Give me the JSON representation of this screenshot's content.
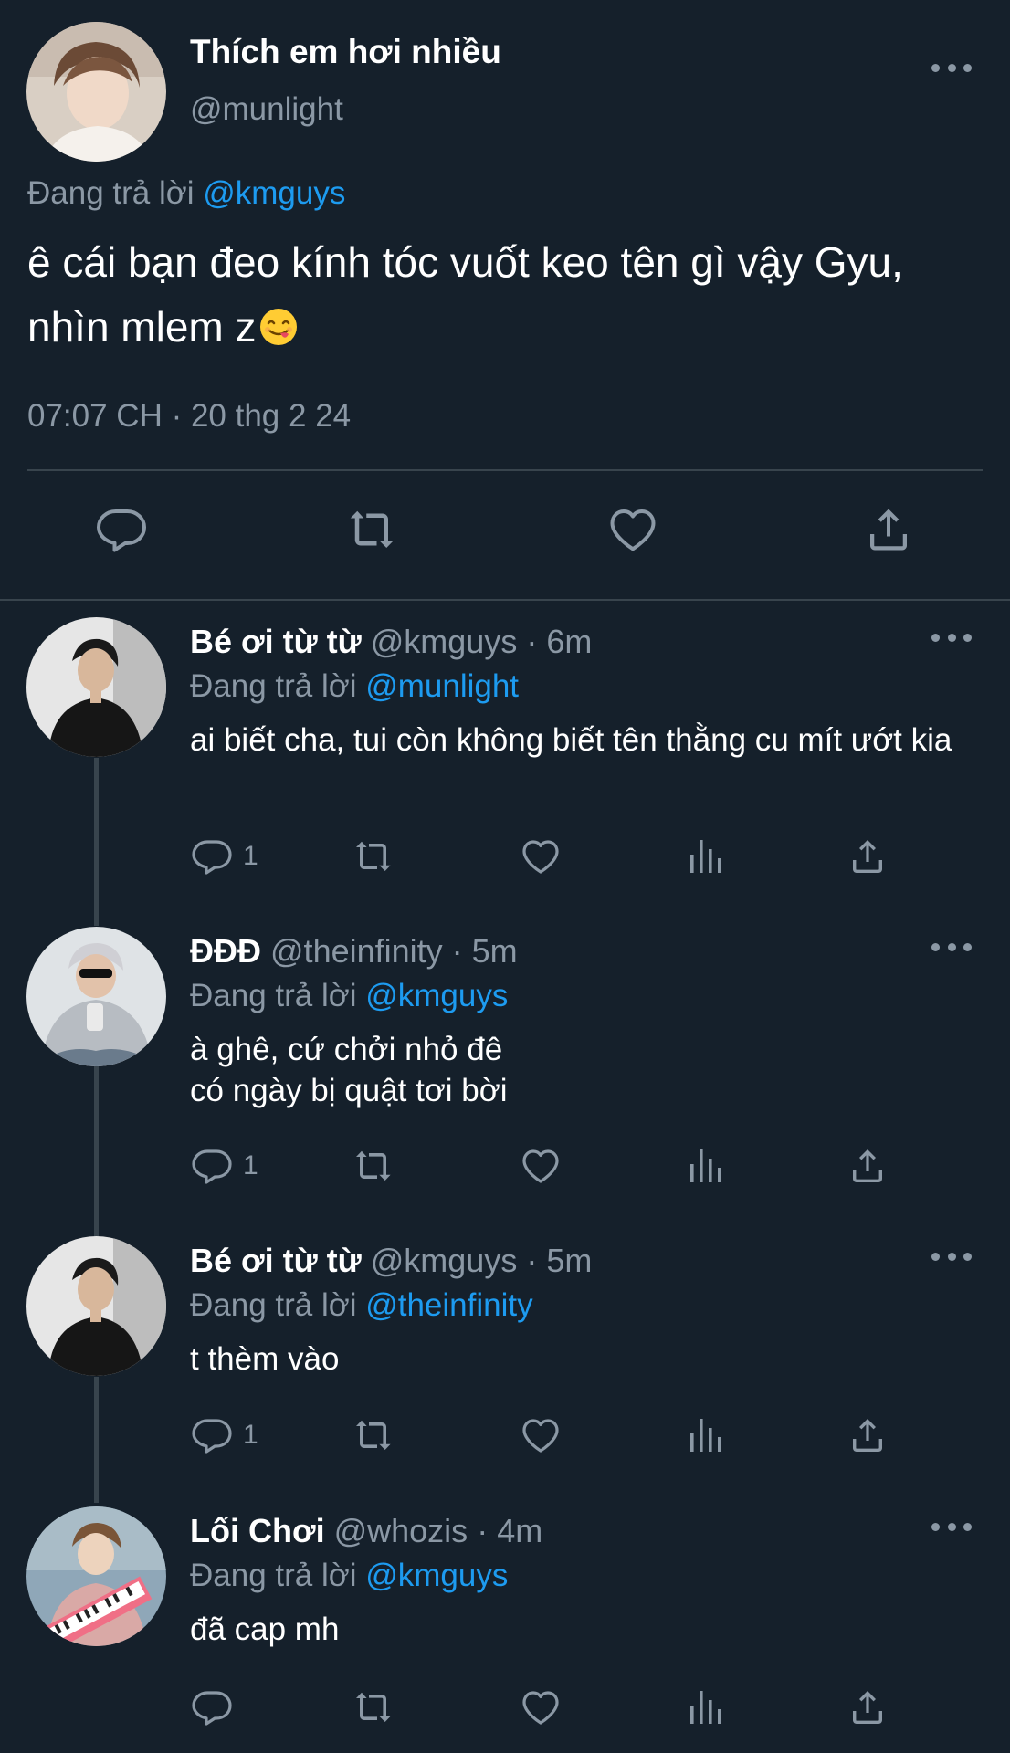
{
  "main_tweet": {
    "display_name": "Thích em hơi nhiều",
    "handle": "@munlight",
    "replying_prefix": "Đang trả lời",
    "replying_to": "@kmguys",
    "text": "ê cái bạn đeo kính tóc vuốt keo tên gì vậy Gyu, nhìn mlem z",
    "emoji": "face-savoring-food-emoji",
    "timestamp": "07:07 CH · 20 thg 2 24",
    "actions": [
      "reply-icon",
      "retweet-icon",
      "like-icon",
      "share-icon"
    ]
  },
  "replies": [
    {
      "display_name": "Bé ơi từ từ",
      "handle": "@kmguys",
      "time": "· 6m",
      "replying_prefix": "Đang trả lời",
      "replying_to": "@munlight",
      "text": "ai biết cha, tui còn không biết tên thằng cu mít ướt kia",
      "reply_count": "1"
    },
    {
      "display_name": "ĐĐĐ",
      "handle": "@theinfinity",
      "time": "· 5m",
      "replying_prefix": "Đang trả lời",
      "replying_to": "@kmguys",
      "text_line1": "à ghê, cứ chởi nhỏ đê",
      "text_line2": "có ngày bị quật tơi bời",
      "reply_count": "1"
    },
    {
      "display_name": "Bé ơi từ từ",
      "handle": "@kmguys",
      "time": "· 5m",
      "replying_prefix": "Đang trả lời",
      "replying_to": "@theinfinity",
      "text": "t thèm vào",
      "reply_count": "1"
    },
    {
      "display_name": "Lối Chơi",
      "handle": "@whozis",
      "time": "· 4m",
      "replying_prefix": "Đang trả lời",
      "replying_to": "@kmguys",
      "text": "đã cap mh",
      "reply_count": ""
    }
  ],
  "colors": {
    "background": "#15202b",
    "text_primary": "#ffffff",
    "text_secondary": "#8b98a5",
    "link": "#1d9bf0",
    "divider": "#38444d"
  }
}
